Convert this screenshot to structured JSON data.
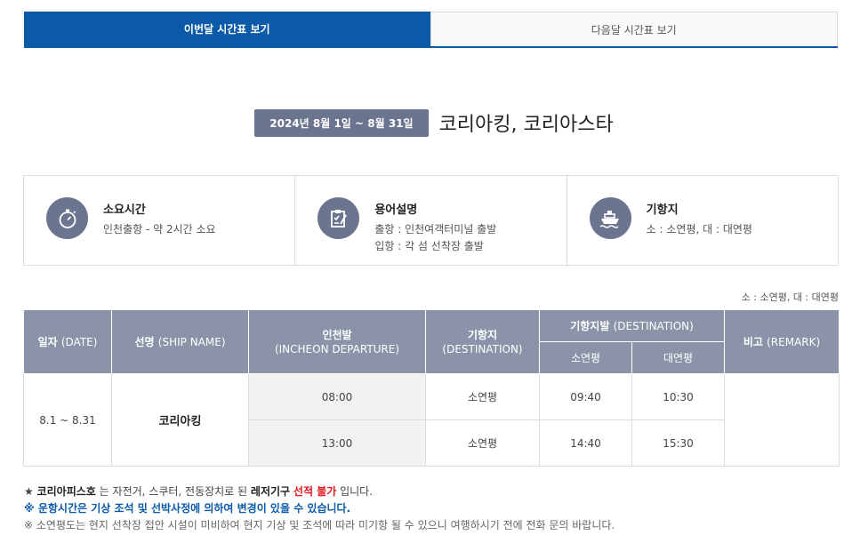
{
  "tabs": [
    {
      "label": "이번달 시간표 보기",
      "active": true
    },
    {
      "label": "다음달 시간표 보기",
      "active": false
    }
  ],
  "period": {
    "badge": "2024년 8월 1일 ~ 8월 31일",
    "title": "코리아킹, 코리아스타"
  },
  "info": {
    "duration": {
      "icon": "stopwatch-icon",
      "title": "소요시간",
      "line1": "인천출항 - 약 2시간 소요"
    },
    "terms": {
      "icon": "clipboard-check-icon",
      "title": "용어설명",
      "line1": "출항 : 인천여객터미널 출발",
      "line2": "입항 : 각 섬 선착장 출발"
    },
    "port": {
      "icon": "ship-icon",
      "title": "기항지",
      "line1": "소 : 소연평, 대 : 대연평"
    }
  },
  "legend_note": "소 : 소연평, 대 : 대연평",
  "table": {
    "headers": {
      "date_ko": "일자",
      "date_en": "(DATE)",
      "ship_ko": "선명",
      "ship_en": "(SHIP NAME)",
      "incheon_ko": "인천발",
      "incheon_en": "(INCHEON DEPARTURE)",
      "dest_ko": "기항지",
      "dest_en": "(DESTINATION)",
      "destdep_ko": "기항지발",
      "destdep_en": "(DESTINATION)",
      "so": "소연평",
      "dae": "대연평",
      "remark_ko": "비고",
      "remark_en": "(REMARK)"
    },
    "date": "8.1 ~ 8.31",
    "ship": "코리아킹",
    "rows": [
      {
        "departure": "08:00",
        "destination": "소연평",
        "so": "09:40",
        "dae": "10:30"
      },
      {
        "departure": "13:00",
        "destination": "소연평",
        "so": "14:40",
        "dae": "15:30"
      }
    ],
    "remark": ""
  },
  "notes": {
    "line1_star": "★",
    "line1_ship": "코리아피스호",
    "line1_mid": "는 자전거, 스쿠터, 전동장치로 된",
    "line1_leisure": "레저기구",
    "line1_red": "선적 불가",
    "line1_end": "입니다.",
    "line2": "※ 운항시간은 기상 조석 및 선박사정에 의하여 변경이 있을 수 있습니다.",
    "line3": "※ 소연평도는 현지 선착장 접안 시설이 미비하여 현지 기상 및 조석에 따라 미기항 될 수 있으니 여행하시기 전에 전화 문의 바랍니다."
  },
  "colors": {
    "primary": "#0b5aa8",
    "header_bg": "#8a93a8",
    "badge_bg": "#6b7590",
    "red": "#e0161f"
  }
}
